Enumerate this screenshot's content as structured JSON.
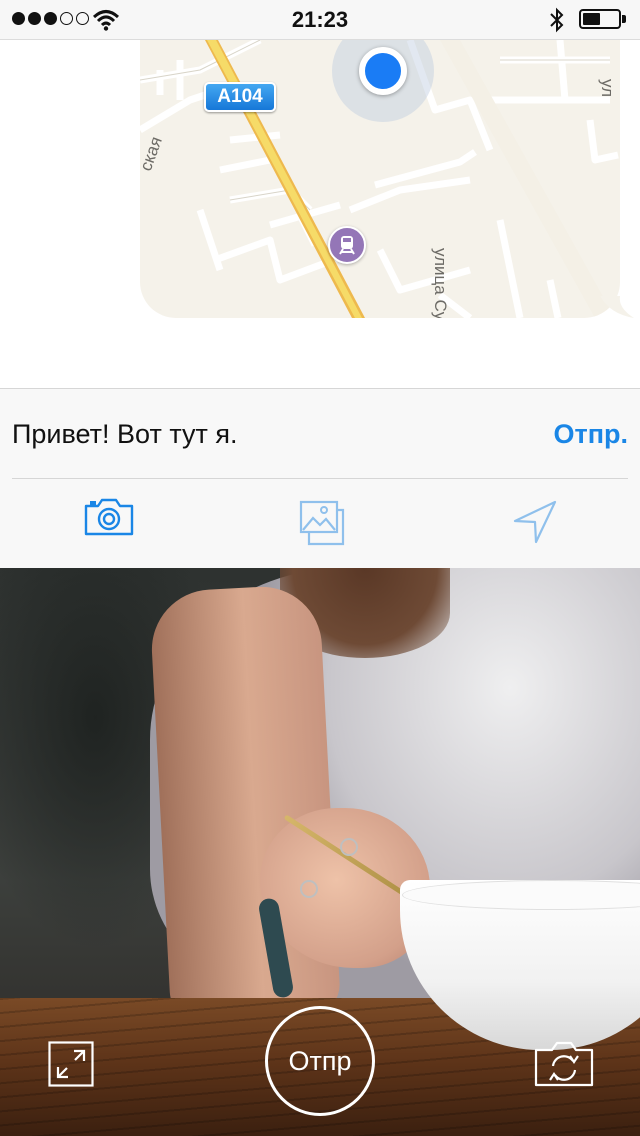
{
  "status_bar": {
    "time": "21:23",
    "signal_bars_filled": 3,
    "signal_bars_total": 5,
    "battery_level": 0.5
  },
  "map": {
    "road_badge": "A104",
    "street_label_right": "улица Сущевская",
    "street_label_left": "ская",
    "street_label_top_right": "ул",
    "location_dot_color": "#1a7cf5",
    "road_color": "#f3d35b"
  },
  "composer": {
    "message_text": "Привет! Вот тут я.",
    "send_label": "Отпр.",
    "accent_color": "#1a86e6",
    "tools": [
      "camera-icon",
      "photo-library-icon",
      "location-arrow-icon"
    ]
  },
  "photo_controls": {
    "shutter_label": "Отпр",
    "left_icon": "expand-icon",
    "right_icon": "switch-camera-icon"
  }
}
